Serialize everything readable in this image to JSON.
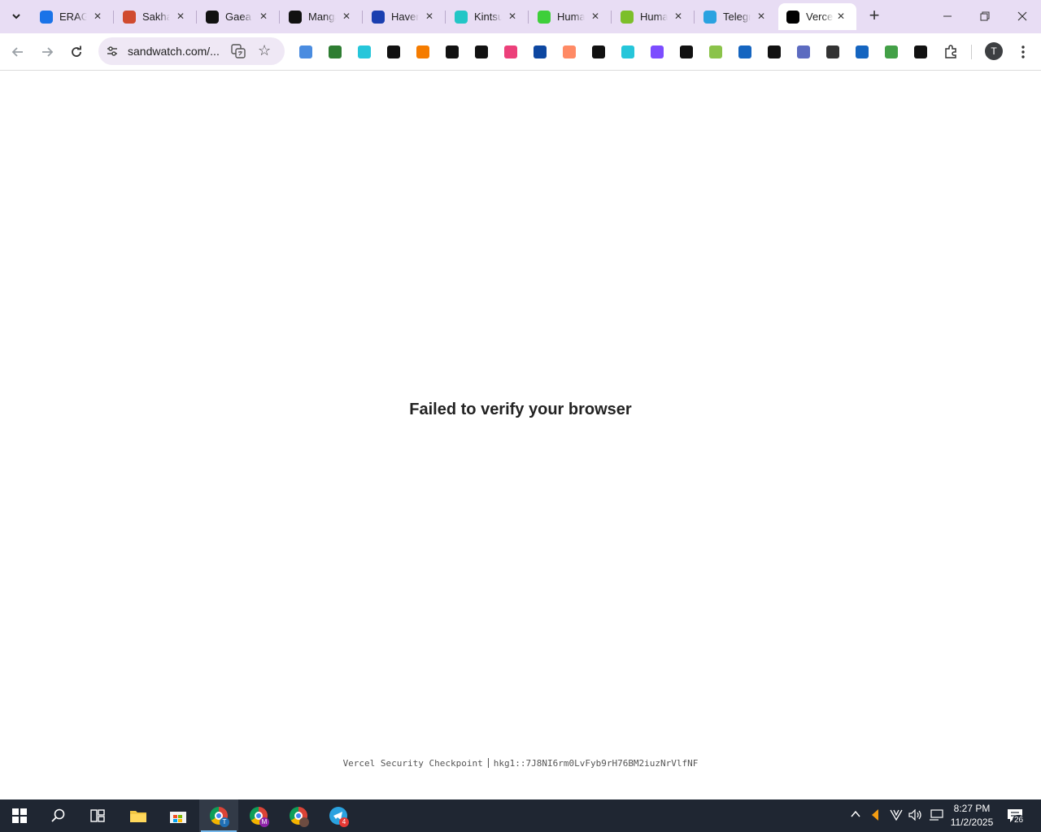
{
  "tabs": [
    {
      "title": "ERAGO",
      "color": "#1a73e8"
    },
    {
      "title": "Sakha",
      "color": "#d04b2f"
    },
    {
      "title": "Gaea",
      "color": "#111111"
    },
    {
      "title": "Manga",
      "color": "#111111"
    },
    {
      "title": "Haven",
      "color": "#1a3fb0"
    },
    {
      "title": "Kintsu",
      "color": "#22c6c6"
    },
    {
      "title": "Huma",
      "color": "#3ecf3a"
    },
    {
      "title": "Huma",
      "color": "#7cbf2a"
    },
    {
      "title": "Telegr",
      "color": "#2aa2e0"
    },
    {
      "title": "Vercel",
      "color": "#000000"
    }
  ],
  "address": {
    "url": "sandwatch.com/..."
  },
  "profile_initial": "T",
  "extension_colors": [
    "#4a8ce0",
    "#2e7d32",
    "#26c6da",
    "#111111",
    "#f57c00",
    "#111111",
    "#111111",
    "#ec407a",
    "#0d47a1",
    "#ff8a65",
    "#111111",
    "#26c6da",
    "#7c4dff",
    "#111111",
    "#8bc34a",
    "#1565c0",
    "#111111",
    "#5c6bc0",
    "#333333",
    "#1565c0",
    "#43a047",
    "#111111"
  ],
  "page": {
    "message": "Failed to verify your browser",
    "footer_label": "Vercel Security Checkpoint",
    "footer_id": "hkg1::7J8NI6rm0LvFyb9rH76BM2iuzNrVlfNF"
  },
  "taskbar": {
    "chrome_badges": [
      "T",
      "M",
      ""
    ],
    "telegram_badge": "4",
    "time": "8:27 PM",
    "date": "11/2/2025",
    "notifications": "26"
  }
}
